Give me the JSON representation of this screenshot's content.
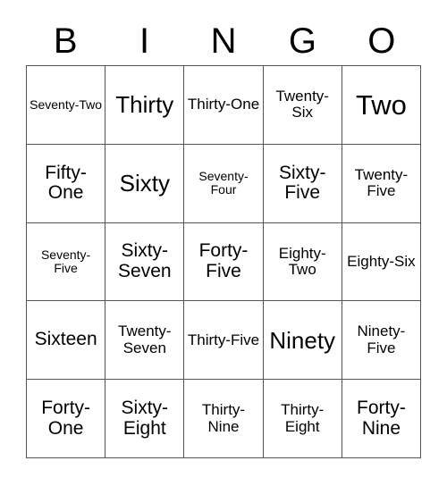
{
  "card": {
    "headers": [
      "B",
      "I",
      "N",
      "G",
      "O"
    ],
    "rows": [
      {
        "cells": [
          {
            "label": "Seventy-Two"
          },
          {
            "label": "Thirty"
          },
          {
            "label": "Thirty-One"
          },
          {
            "label": "Twenty-Six"
          },
          {
            "label": "Two"
          }
        ]
      },
      {
        "cells": [
          {
            "label": "Fifty-One"
          },
          {
            "label": "Sixty"
          },
          {
            "label": "Seventy-Four"
          },
          {
            "label": "Sixty-Five"
          },
          {
            "label": "Twenty-Five"
          }
        ]
      },
      {
        "cells": [
          {
            "label": "Seventy-Five"
          },
          {
            "label": "Sixty-Seven"
          },
          {
            "label": "Forty-Five"
          },
          {
            "label": "Eighty-Two"
          },
          {
            "label": "Eighty-Six"
          }
        ]
      },
      {
        "cells": [
          {
            "label": "Sixteen"
          },
          {
            "label": "Twenty-Seven"
          },
          {
            "label": "Thirty-Five"
          },
          {
            "label": "Ninety"
          },
          {
            "label": "Ninety-Five"
          }
        ]
      },
      {
        "cells": [
          {
            "label": "Forty-One"
          },
          {
            "label": "Sixty-Eight"
          },
          {
            "label": "Thirty-Nine"
          },
          {
            "label": "Thirty-Eight"
          },
          {
            "label": "Forty-Nine"
          }
        ]
      }
    ],
    "colors": {
      "background": "#ffffff",
      "border": "#555555",
      "text": "#000000"
    }
  }
}
